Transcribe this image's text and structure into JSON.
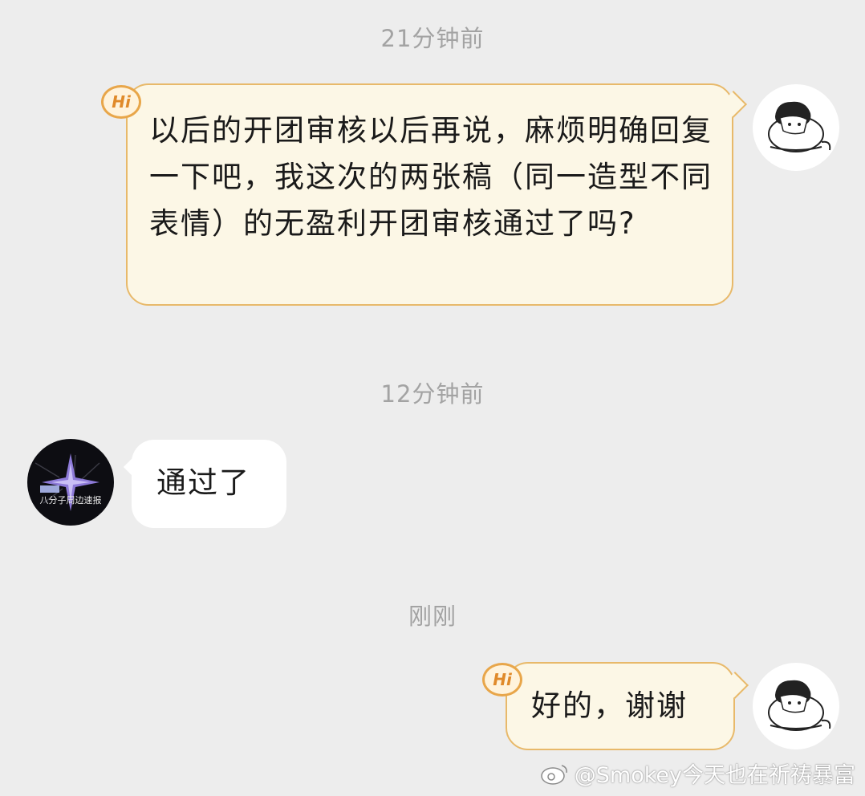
{
  "messages": [
    {
      "timestamp": "21分钟前",
      "text": "以后的开团审核以后再说，麻烦明确回复一下吧，我这次的两张稿（同一造型不同表情）的无盈利开团审核通过了吗?"
    },
    {
      "timestamp": "12分钟前",
      "text": "通过了"
    },
    {
      "timestamp": "刚刚",
      "text": "好的，谢谢"
    }
  ],
  "badges": {
    "hi": "Hi"
  },
  "avatar_other": {
    "caption": "八分子周边速报"
  },
  "watermark": "@Smokey今天也在祈祷暴富",
  "colors": {
    "background": "#ededed",
    "outgoing_bubble": "#fcf7e6",
    "outgoing_border": "#e8b96a",
    "incoming_bubble": "#ffffff",
    "timestamp": "#a3a3a3"
  }
}
